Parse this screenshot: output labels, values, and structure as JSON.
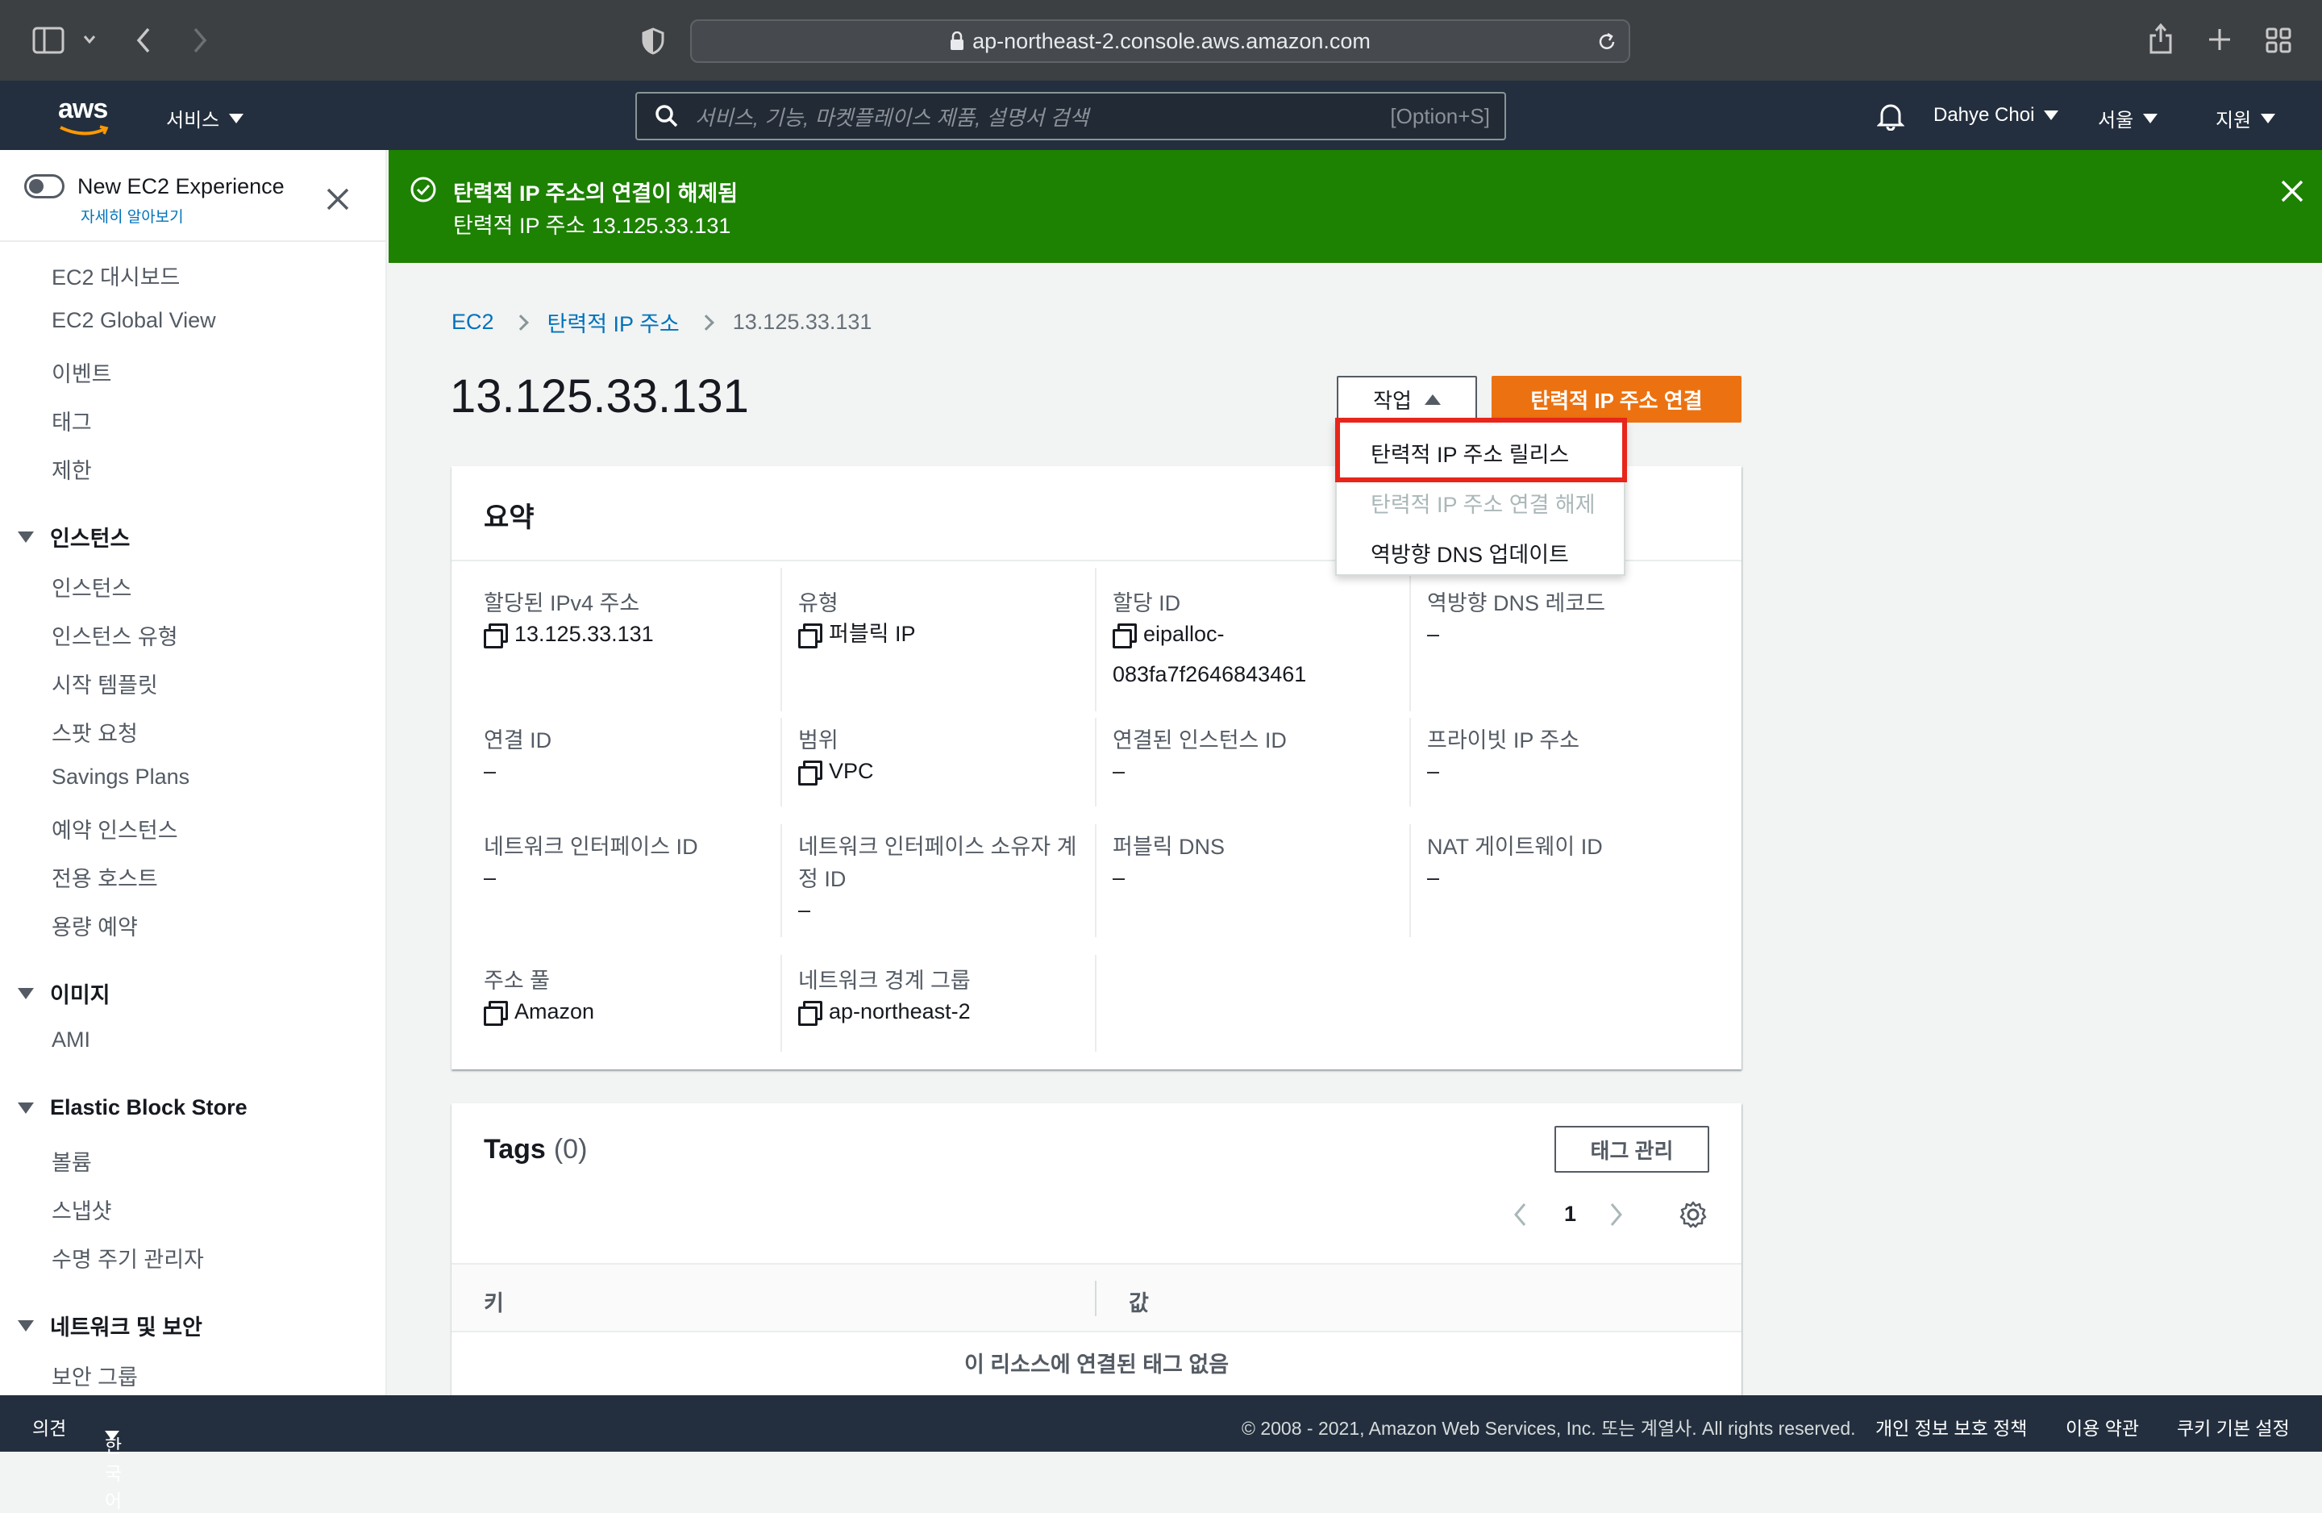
{
  "browser": {
    "url": "ap-northeast-2.console.aws.amazon.com"
  },
  "aws_nav": {
    "logo": "aws",
    "services": "서비스",
    "search_placeholder": "서비스, 기능, 마켓플레이스 제품, 설명서 검색",
    "search_shortcut": "[Option+S]",
    "user": "Dahye Choi",
    "region": "서울",
    "support": "지원"
  },
  "sidebar": {
    "toggle_label": "New EC2 Experience",
    "learn_more": "자세히 알아보기",
    "top_items": [
      "EC2 대시보드",
      "EC2 Global View",
      "이벤트",
      "태그",
      "제한"
    ],
    "sections": [
      {
        "title": "인스턴스",
        "items": [
          "인스턴스",
          "인스턴스 유형",
          "시작 템플릿",
          "스팟 요청",
          "Savings Plans",
          "예약 인스턴스",
          "전용 호스트",
          "용량 예약"
        ]
      },
      {
        "title": "이미지",
        "items": [
          "AMI"
        ]
      },
      {
        "title": "Elastic Block Store",
        "items": [
          "볼륨",
          "스냅샷",
          "수명 주기 관리자"
        ]
      },
      {
        "title": "네트워크 및 보안",
        "items": [
          "보안 그룹"
        ]
      }
    ]
  },
  "flash": {
    "title": "탄력적 IP 주소의 연결이 해제됨",
    "message": "탄력적 IP 주소 13.125.33.131"
  },
  "breadcrumb": [
    "EC2",
    "탄력적 IP 주소",
    "13.125.33.131"
  ],
  "page_title": "13.125.33.131",
  "actions": {
    "actions_label": "작업",
    "primary_label": "탄력적 IP 주소 연결",
    "menu": [
      {
        "label": "탄력적 IP 주소 릴리스",
        "disabled": false,
        "highlighted": true
      },
      {
        "label": "탄력적 IP 주소 연결 해제",
        "disabled": true
      },
      {
        "label": "역방향 DNS 업데이트",
        "disabled": false
      }
    ]
  },
  "summary": {
    "title": "요약",
    "fields": [
      {
        "label": "할당된 IPv4 주소",
        "value": "13.125.33.131",
        "copy": true
      },
      {
        "label": "유형",
        "value": "퍼블릭 IP",
        "copy": true
      },
      {
        "label": "할당 ID",
        "value": "eipalloc-",
        "value2": "083fa7f2646843461",
        "copy": true
      },
      {
        "label": "역방향 DNS 레코드",
        "value": "–",
        "copy": false
      },
      {
        "label": "연결 ID",
        "value": "–",
        "copy": false
      },
      {
        "label": "범위",
        "value": "VPC",
        "copy": true
      },
      {
        "label": "연결된 인스턴스 ID",
        "value": "–",
        "copy": false
      },
      {
        "label": "프라이빗 IP 주소",
        "value": "–",
        "copy": false
      },
      {
        "label": "네트워크 인터페이스 ID",
        "value": "–",
        "copy": false
      },
      {
        "label": "네트워크 인터페이스 소유자 계",
        "label2": "정 ID",
        "value": "–",
        "copy": false
      },
      {
        "label": "퍼블릭 DNS",
        "value": "–",
        "copy": false
      },
      {
        "label": "NAT 게이트웨이 ID",
        "value": "–",
        "copy": false
      },
      {
        "label": "주소 풀",
        "value": "Amazon",
        "copy": true
      },
      {
        "label": "네트워크 경계 그룹",
        "value": "ap-northeast-2",
        "copy": true
      }
    ]
  },
  "tags": {
    "title": "Tags",
    "count": "(0)",
    "manage_button": "태그 관리",
    "page": "1",
    "columns": [
      "키",
      "값"
    ],
    "empty": "이 리소스에 연결된 태그 없음"
  },
  "footer": {
    "feedback": "의견",
    "language": "한국어",
    "copyright": "© 2008 - 2021, Amazon Web Services, Inc. 또는 계열사. All rights reserved.",
    "privacy": "개인 정보 보호 정책",
    "terms": "이용 약관",
    "cookies": "쿠키 기본 설정"
  },
  "colors": {
    "success": "#1d8102",
    "primary": "#ec7211",
    "link": "#0073bb",
    "highlight": "#e8251b",
    "nav": "#232f3e"
  }
}
